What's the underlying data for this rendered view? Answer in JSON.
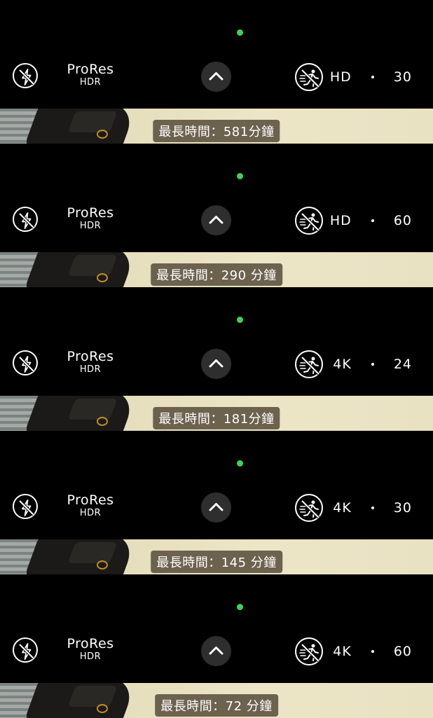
{
  "panels": [
    {
      "label_top": "ProRes",
      "label_bottom": "HDR",
      "resolution": "HD",
      "fps": "30",
      "duration": "最長時間：581分鐘"
    },
    {
      "label_top": "ProRes",
      "label_bottom": "HDR",
      "resolution": "HD",
      "fps": "60",
      "duration": "最長時間：290 分鐘"
    },
    {
      "label_top": "ProRes",
      "label_bottom": "HDR",
      "resolution": "4K",
      "fps": "24",
      "duration": "最長時間：181分鐘"
    },
    {
      "label_top": "ProRes",
      "label_bottom": "HDR",
      "resolution": "4K",
      "fps": "30",
      "duration": "最長時間：145 分鐘"
    },
    {
      "label_top": "ProRes",
      "label_bottom": "HDR",
      "resolution": "4K",
      "fps": "60",
      "duration": "最長時間：72 分鐘"
    }
  ],
  "icons": {
    "flash": "flash-off-icon",
    "chevron": "chevron-up-icon",
    "action_mode": "action-mode-off-icon"
  },
  "colors": {
    "recording_dot": "#3fd15a",
    "bar_background": "#000000",
    "chevron_background": "#2e2e2e",
    "duration_badge": "#5a503e"
  }
}
